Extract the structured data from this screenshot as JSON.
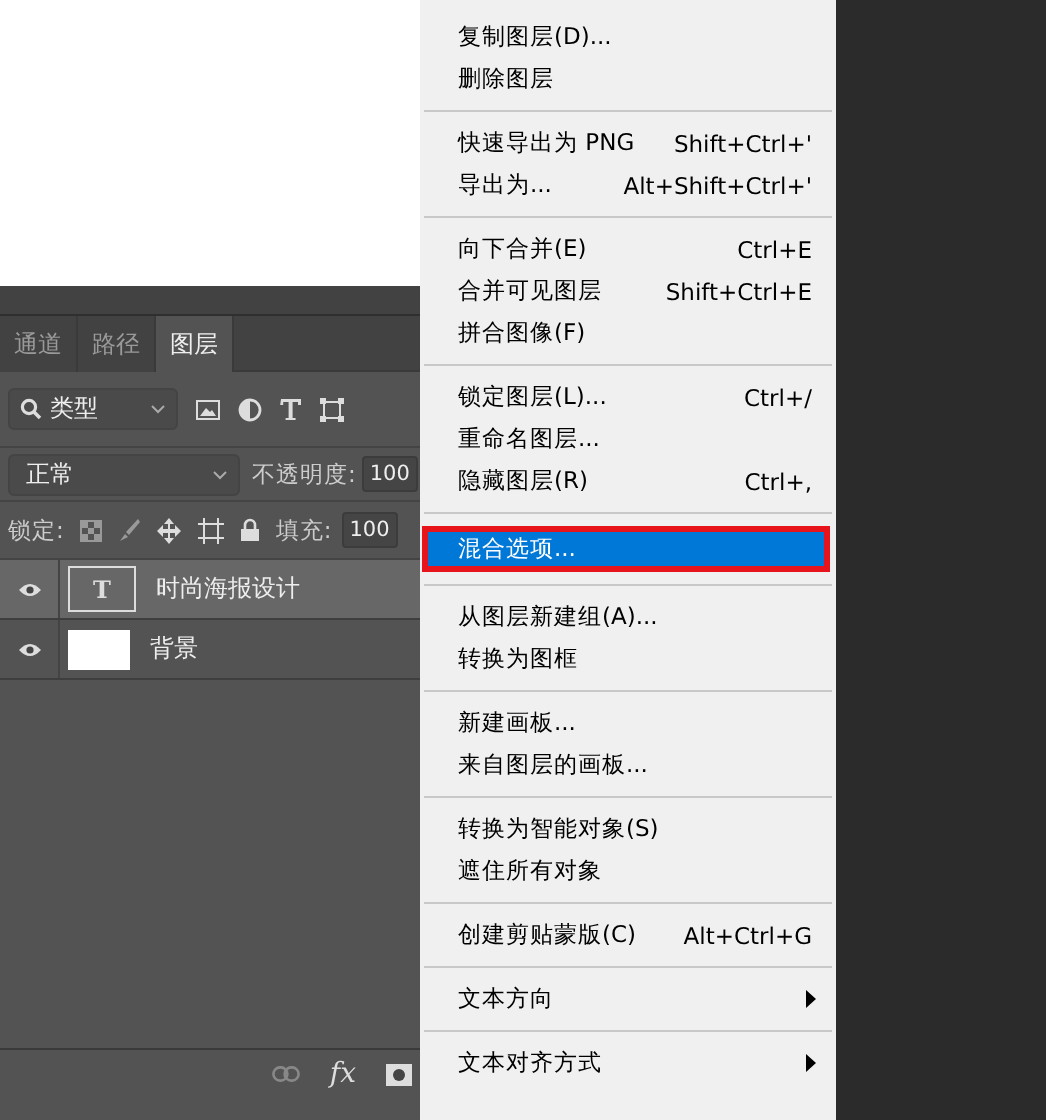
{
  "layers_panel": {
    "tabs": [
      {
        "label": "通道",
        "selected": false
      },
      {
        "label": "路径",
        "selected": false
      },
      {
        "label": "图层",
        "selected": true
      }
    ],
    "filter": {
      "value": "类型"
    },
    "blend_mode": {
      "value": "正常"
    },
    "opacity": {
      "label": "不透明度:",
      "value": "100"
    },
    "lock": {
      "label": "锁定:"
    },
    "fill": {
      "label": "填充:",
      "value": "100"
    },
    "layers": [
      {
        "name": "时尚海报设计",
        "kind": "text",
        "thumb_text": "T",
        "visible": true,
        "selected": true
      },
      {
        "name": "背景",
        "kind": "image",
        "visible": true,
        "selected": false
      }
    ],
    "footer": {
      "fx": "fx"
    }
  },
  "context_menu": {
    "groups": [
      [
        {
          "label": "复制图层(D)...",
          "selected": false
        },
        {
          "label": "删除图层",
          "selected": false
        }
      ],
      [
        {
          "label": "快速导出为 PNG",
          "shortcut": "Shift+Ctrl+'",
          "selected": false
        },
        {
          "label": "导出为...",
          "shortcut": "Alt+Shift+Ctrl+'",
          "selected": false
        }
      ],
      [
        {
          "label": "向下合并(E)",
          "shortcut": "Ctrl+E",
          "selected": false
        },
        {
          "label": "合并可见图层",
          "shortcut": "Shift+Ctrl+E",
          "selected": false
        },
        {
          "label": "拼合图像(F)",
          "selected": false
        }
      ],
      [
        {
          "label": "锁定图层(L)...",
          "shortcut": "Ctrl+/",
          "selected": false
        },
        {
          "label": "重命名图层...",
          "selected": false
        },
        {
          "label": "隐藏图层(R)",
          "shortcut": "Ctrl+,",
          "selected": false
        }
      ],
      [
        {
          "label": "混合选项...",
          "selected": true
        }
      ],
      [
        {
          "label": "从图层新建组(A)...",
          "selected": false
        },
        {
          "label": "转换为图框",
          "selected": false
        }
      ],
      [
        {
          "label": "新建画板...",
          "selected": false
        },
        {
          "label": "来自图层的画板...",
          "selected": false
        }
      ],
      [
        {
          "label": "转换为智能对象(S)",
          "selected": false
        },
        {
          "label": "遮住所有对象",
          "selected": false
        }
      ],
      [
        {
          "label": "创建剪贴蒙版(C)",
          "shortcut": "Alt+Ctrl+G",
          "selected": false
        }
      ],
      [
        {
          "label": "文本方向",
          "submenu": true,
          "selected": false
        }
      ],
      [
        {
          "label": "文本对齐方式",
          "submenu": true,
          "selected": false
        }
      ]
    ]
  }
}
